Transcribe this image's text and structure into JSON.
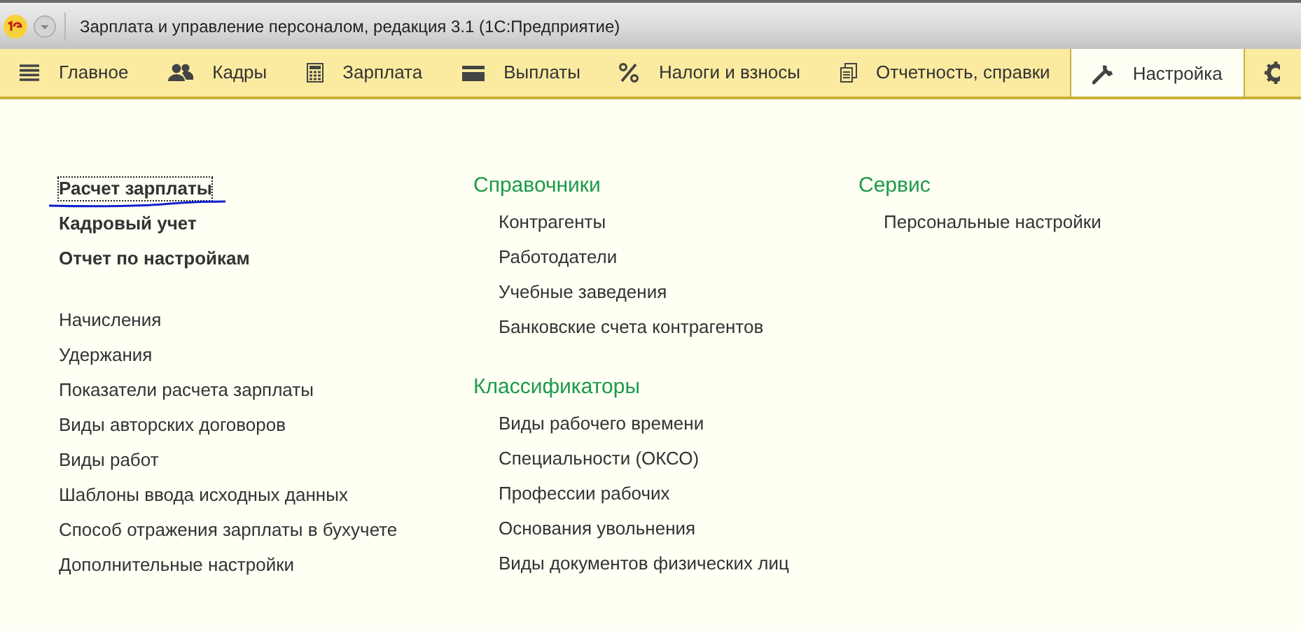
{
  "window": {
    "title": "Зарплата и управление персоналом, редакция 3.1  (1С:Предприятие)"
  },
  "sections": [
    {
      "label": "Главное",
      "selected": false
    },
    {
      "label": "Кадры",
      "selected": false
    },
    {
      "label": "Зарплата",
      "selected": false
    },
    {
      "label": "Выплаты",
      "selected": false
    },
    {
      "label": "Налоги и взносы",
      "selected": false
    },
    {
      "label": "Отчетность, справки",
      "selected": false
    },
    {
      "label": "Настройка",
      "selected": true
    },
    {
      "selected": false
    }
  ],
  "left_groups": [
    {
      "bold": true,
      "items": [
        {
          "label": "Расчет зарплаты",
          "focused": true,
          "underlined": true
        },
        {
          "label": "Кадровый учет",
          "focused": false,
          "underlined": false
        },
        {
          "label": "Отчет по настройкам",
          "focused": false,
          "underlined": false
        }
      ]
    },
    {
      "bold": false,
      "items": [
        {
          "label": "Начисления",
          "focused": false,
          "underlined": false
        },
        {
          "label": "Удержания",
          "focused": false,
          "underlined": false
        },
        {
          "label": "Показатели расчета зарплаты",
          "focused": false,
          "underlined": false
        },
        {
          "label": "Виды авторских договоров",
          "focused": false,
          "underlined": false
        },
        {
          "label": "Виды работ",
          "focused": false,
          "underlined": false
        },
        {
          "label": "Шаблоны ввода исходных данных",
          "focused": false,
          "underlined": false
        },
        {
          "label": "Способ отражения зарплаты в бухучете",
          "focused": false,
          "underlined": false
        },
        {
          "label": "Дополнительные настройки",
          "focused": false,
          "underlined": false
        }
      ]
    }
  ],
  "middle_groups": [
    {
      "title": "Справочники",
      "items": [
        "Контрагенты",
        "Работодатели",
        "Учебные заведения",
        "Банковские счета контрагентов"
      ]
    },
    {
      "title": "Классификаторы",
      "items": [
        "Виды рабочего времени",
        "Специальности (ОКСО)",
        "Профессии рабочих",
        "Основания увольнения",
        "Виды документов физических лиц"
      ]
    }
  ],
  "right_groups": [
    {
      "title": "Сервис",
      "items": [
        "Персональные настройки"
      ]
    }
  ]
}
